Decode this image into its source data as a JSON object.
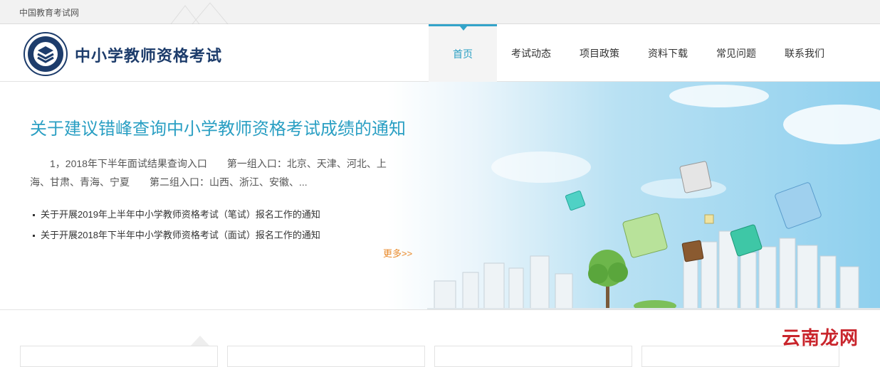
{
  "topbar": {
    "site_link": "中国教育考试网"
  },
  "header": {
    "title": "中小学教师资格考试"
  },
  "nav": {
    "items": [
      {
        "label": "首页"
      },
      {
        "label": "考试动态"
      },
      {
        "label": "项目政策"
      },
      {
        "label": "资料下载"
      },
      {
        "label": "常见问题"
      },
      {
        "label": "联系我们"
      }
    ]
  },
  "banner": {
    "headline": "关于建议错峰查询中小学教师资格考试成绩的通知",
    "summary": "1，2018年下半年面试结果查询入口　　第一组入口：北京、天津、河北、上海、甘肃、青海、宁夏　　第二组入口：山西、浙江、安徽、...",
    "news": [
      {
        "title": "关于开展2019年上半年中小学教师资格考试（笔试）报名工作的通知"
      },
      {
        "title": "关于开展2018年下半年中小学教师资格考试（面试）报名工作的通知"
      }
    ],
    "more": "更多>>"
  },
  "watermark": "云南龙网",
  "colors": {
    "accent": "#2a9fc3",
    "more": "#e98a2b",
    "title": "#1d3c6b"
  }
}
